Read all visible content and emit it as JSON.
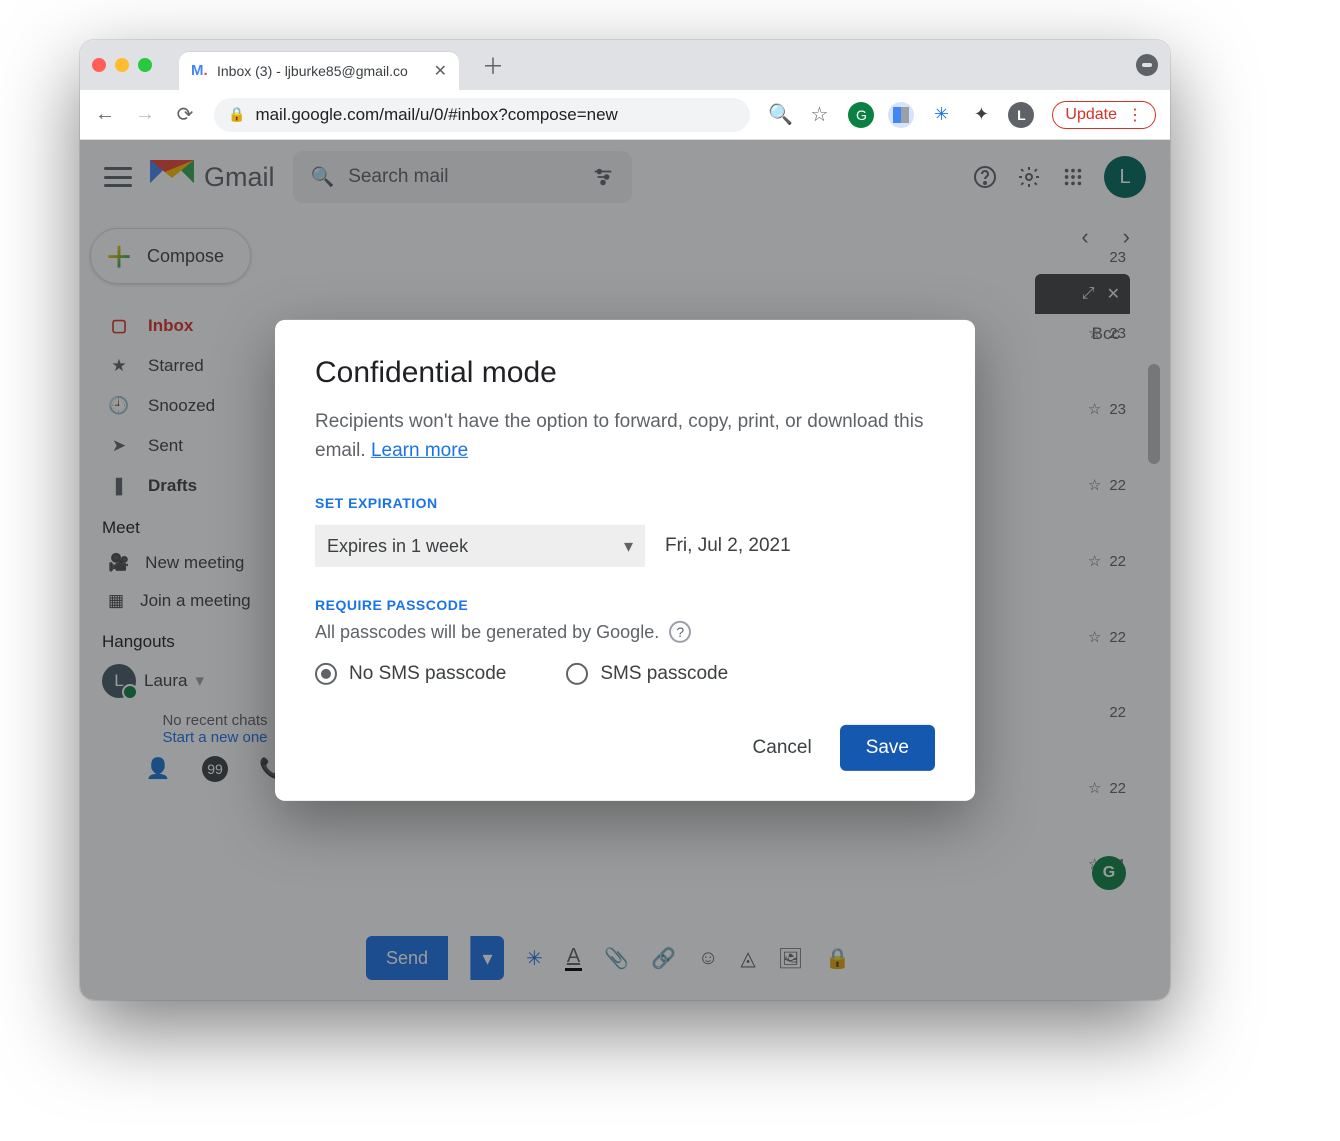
{
  "browser": {
    "tab_title": "Inbox (3) - ljburke85@gmail.co",
    "url": "mail.google.com/mail/u/0/#inbox?compose=new",
    "update_label": "Update"
  },
  "header": {
    "product": "Gmail",
    "search_placeholder": "Search mail",
    "avatar_initial": "L"
  },
  "sidebar": {
    "compose": "Compose",
    "items": [
      {
        "icon": "inbox",
        "label": "Inbox",
        "selected": true
      },
      {
        "icon": "star",
        "label": "Starred"
      },
      {
        "icon": "clock",
        "label": "Snoozed"
      },
      {
        "icon": "send",
        "label": "Sent"
      },
      {
        "icon": "file",
        "label": "Drafts",
        "bold": true
      }
    ],
    "meet_label": "Meet",
    "meet_items": [
      {
        "icon": "cam",
        "label": "New meeting"
      },
      {
        "icon": "keypad",
        "label": "Join a meeting"
      }
    ],
    "hangouts_label": "Hangouts",
    "user": "Laura",
    "no_recent": "No recent chats",
    "start_new": "Start a new one"
  },
  "mail": {
    "bcc": "Bcc",
    "send": "Send",
    "times": [
      "23",
      "23",
      "23",
      "22",
      "22",
      "22",
      "22",
      "22",
      "21"
    ]
  },
  "modal": {
    "title": "Confidential mode",
    "desc": "Recipients won't have the option to forward, copy, print, or download this email. ",
    "learn": "Learn more",
    "sect_exp": "SET EXPIRATION",
    "exp_option": "Expires in 1 week",
    "exp_date": "Fri, Jul 2, 2021",
    "sect_pass": "REQUIRE PASSCODE",
    "pass_info": "All passcodes will be generated by Google.",
    "radios": {
      "no": "No SMS passcode",
      "yes": "SMS passcode",
      "selected": "no"
    },
    "cancel": "Cancel",
    "save": "Save"
  }
}
